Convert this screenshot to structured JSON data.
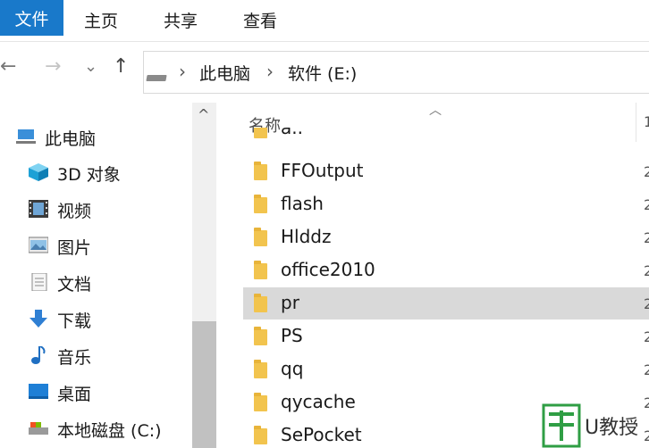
{
  "ribbon": {
    "tabs": [
      "文件",
      "主页",
      "共享",
      "查看"
    ]
  },
  "nav": {
    "back": "←",
    "forward": "→",
    "recent": "⌄",
    "up": "↑",
    "breadcrumb": [
      "此电脑",
      "软件 (E:)"
    ],
    "separator": "›"
  },
  "navpane": {
    "items": [
      {
        "label": "此电脑",
        "icon": "computer-icon"
      },
      {
        "label": "3D 对象",
        "icon": "cube-3d-icon"
      },
      {
        "label": "视频",
        "icon": "video-icon"
      },
      {
        "label": "图片",
        "icon": "picture-icon"
      },
      {
        "label": "文档",
        "icon": "document-icon"
      },
      {
        "label": "下载",
        "icon": "download-icon"
      },
      {
        "label": "音乐",
        "icon": "music-icon"
      },
      {
        "label": "桌面",
        "icon": "desktop-icon"
      },
      {
        "label": "本地磁盘 (C:)",
        "icon": "drive-icon"
      }
    ]
  },
  "filelist": {
    "column_name": "名称",
    "column_date_peek": "1",
    "partial_top": "a..",
    "rows": [
      "FFOutput",
      "flash",
      "Hlddz",
      "office2010",
      "pr",
      "PS",
      "qq",
      "qycache",
      "SePocket"
    ],
    "selected": "pr",
    "date_peek": "2"
  },
  "scroll": {
    "up": "^"
  },
  "watermark": {
    "text": "U教授"
  }
}
